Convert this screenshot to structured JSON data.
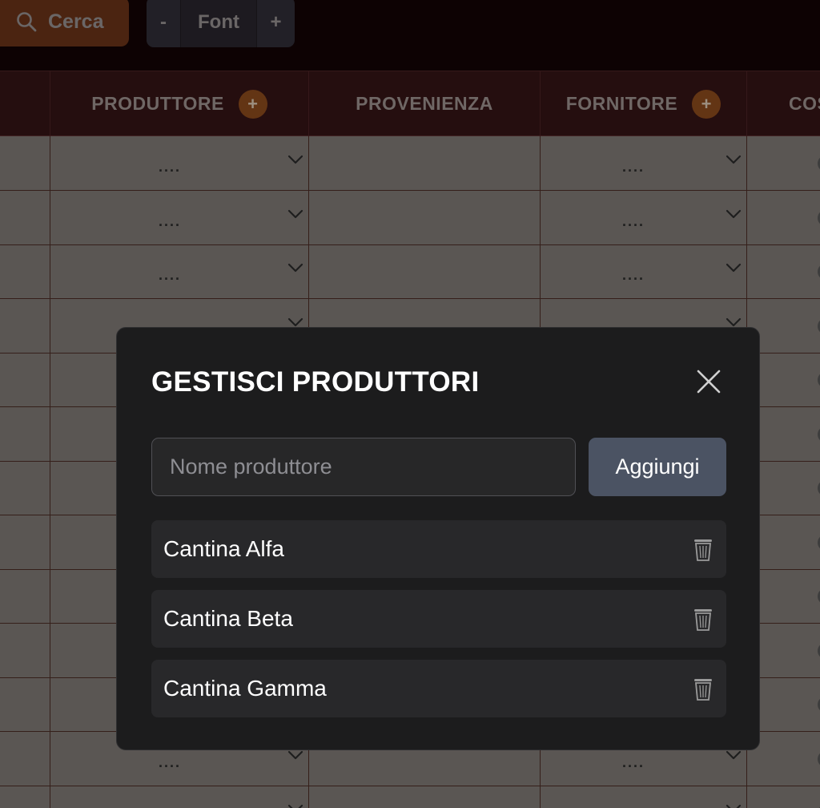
{
  "toolbar": {
    "search_label": "Cerca",
    "font_minus": "-",
    "font_label": "Font",
    "font_plus": "+"
  },
  "table": {
    "columns": [
      {
        "label": ""
      },
      {
        "label": "PRODUTTORE",
        "add": "+"
      },
      {
        "label": "PROVENIENZA"
      },
      {
        "label": "FORNITORE",
        "add": "+"
      },
      {
        "label": "COS"
      }
    ],
    "placeholder": "....",
    "rows_with_values": [
      0,
      1,
      2,
      11
    ]
  },
  "modal": {
    "title": "GESTISCI PRODUTTORI",
    "input_placeholder": "Nome produttore",
    "add_label": "Aggiungi",
    "items": [
      {
        "name": "Cantina Alfa"
      },
      {
        "name": "Cantina Beta"
      },
      {
        "name": "Cantina Gamma"
      }
    ]
  },
  "colors": {
    "accent": "#b05a28",
    "header_bg": "#341416",
    "modal_bg": "#1c1c1d"
  }
}
